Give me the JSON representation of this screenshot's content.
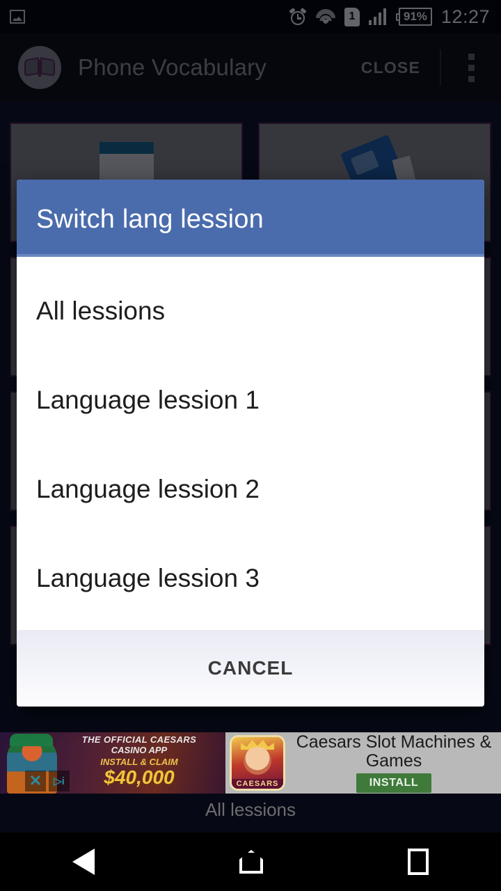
{
  "status_bar": {
    "notification_icon": "photo-icon",
    "alarm_icon": "alarm-clock-icon",
    "wifi_icon": "wifi-icon",
    "sim_label": "1",
    "signal_icon": "signal-bars-icon",
    "battery_level": "91%",
    "time": "12:27"
  },
  "app_bar": {
    "app_icon": "open-book-icon",
    "title": "Phone Vocabulary",
    "close_label": "CLOSE",
    "overflow_icon": "overflow-menu-icon"
  },
  "dialog": {
    "title": "Switch lang lession",
    "items": [
      {
        "label": "All lessions"
      },
      {
        "label": "Language lession 1"
      },
      {
        "label": "Language lession 2"
      },
      {
        "label": "Language lession 3"
      }
    ],
    "cancel_label": "CANCEL",
    "header_color": "#4a6cac",
    "accent_color": "#6a88c0"
  },
  "background": {
    "rows": [
      [
        {
          "icon": "document-icon"
        },
        {
          "icon": "book-icon"
        }
      ],
      [
        {
          "icon": "document-icon"
        },
        {
          "icon": "book-icon"
        }
      ],
      [
        {
          "icon": "document-icon"
        },
        {
          "icon": "book-icon"
        }
      ],
      [
        {
          "icon": "document-icon"
        },
        {
          "icon": "book-icon"
        }
      ]
    ]
  },
  "ad": {
    "art_line1": "THE OFFICIAL CAESARS",
    "art_line2": "CASINO APP",
    "art_line3": "INSTALL & CLAIM",
    "art_amount": "$40,000",
    "close_label": "✕",
    "adchoices_label": "▷i",
    "thumb_brand": "CAESARS",
    "title": "Caesars Slot Machines & Games",
    "install_label": "INSTALL",
    "install_color": "#3f7a3b"
  },
  "footer": {
    "label": "All lessions"
  },
  "nav_bar": {
    "back_icon": "back-triangle-icon",
    "home_icon": "home-pentagon-icon",
    "recents_icon": "recents-square-icon"
  }
}
